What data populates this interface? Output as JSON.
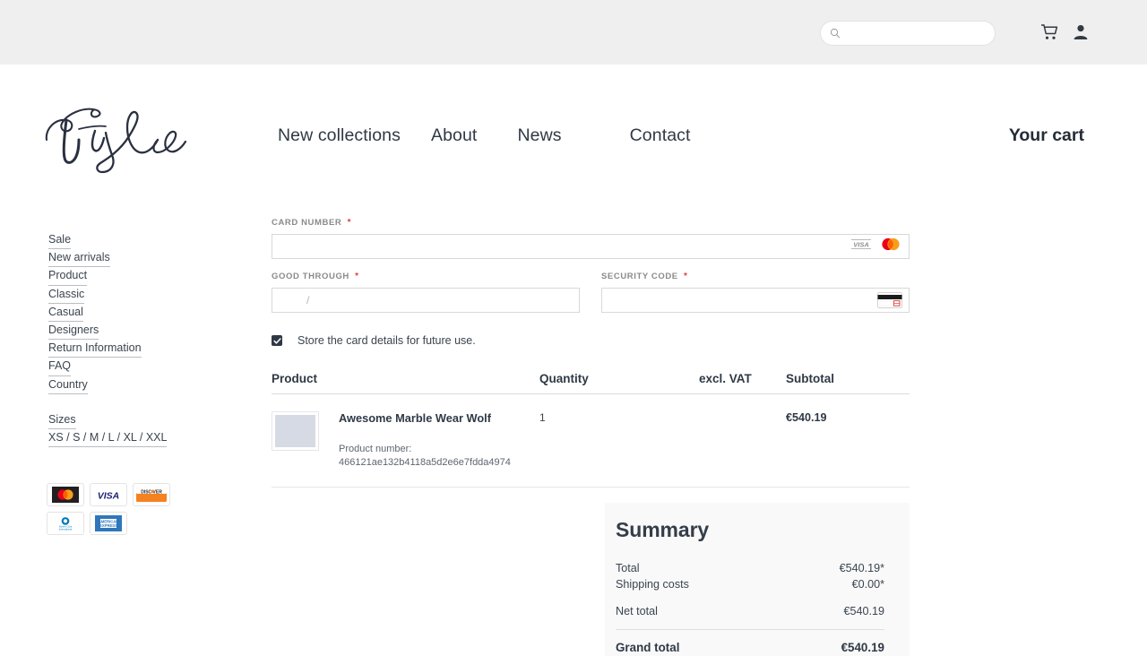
{
  "topbar": {
    "search": {
      "value": "",
      "placeholder": "",
      "icon": "search-icon"
    },
    "cart_icon": "shopping-cart-icon",
    "account_icon": "user-account-icon"
  },
  "header": {
    "logo_text": "Style",
    "nav": [
      {
        "label": "New collections"
      },
      {
        "label": "About"
      },
      {
        "label": "News"
      },
      {
        "label": "Contact"
      }
    ],
    "cart_link": "Your cart"
  },
  "sidebar": {
    "links": [
      {
        "label": "Sale"
      },
      {
        "label": "New arrivals"
      },
      {
        "label": "Product"
      },
      {
        "label": "Classic"
      },
      {
        "label": "Casual"
      },
      {
        "label": "Designers"
      },
      {
        "label": "Return Information"
      },
      {
        "label": "FAQ"
      },
      {
        "label": "Country"
      }
    ],
    "sizes_heading": "Sizes",
    "sizes_value": "XS / S / M / L / XL / XXL",
    "payment_badges": [
      {
        "name": "mastercard-badge",
        "label": "Mastercard"
      },
      {
        "name": "visa-badge",
        "label": "VISA"
      },
      {
        "name": "discover-badge",
        "label": "DISCOVER"
      },
      {
        "name": "diners-club-badge",
        "label": "Diners Club International"
      },
      {
        "name": "amex-badge",
        "label": "AMERICAN EXPRESS"
      }
    ]
  },
  "payment_form": {
    "card_number": {
      "label": "CARD NUMBER",
      "required_mark": "*",
      "value": "",
      "placeholder": "",
      "icons": [
        "visa-icon",
        "mastercard-icon"
      ]
    },
    "good_through": {
      "label": "GOOD THROUGH",
      "required_mark": "*",
      "value": "",
      "placeholder": "/"
    },
    "security_code": {
      "label": "SECURITY CODE",
      "required_mark": "*",
      "value": "",
      "placeholder": "",
      "icon": "cvv-card-icon"
    },
    "store_card": {
      "label": "Store the card details for future use.",
      "checked": true
    }
  },
  "cart_table": {
    "headers": {
      "product": "Product",
      "quantity": "Quantity",
      "vat": "excl. VAT",
      "subtotal": "Subtotal"
    },
    "rows": [
      {
        "name": "Awesome Marble Wear Wolf",
        "product_number_label": "Product number:",
        "product_number": "466121ae132b4118a5d2e6e7fdda4974",
        "quantity": "1",
        "vat": "",
        "subtotal": "€540.19"
      }
    ]
  },
  "summary": {
    "title": "Summary",
    "rows": [
      {
        "label": "Total",
        "value": "€540.19*"
      },
      {
        "label": "Shipping costs",
        "value": "€0.00*"
      },
      {
        "label": "Net total",
        "value": "€540.19"
      }
    ],
    "grand_total": {
      "label": "Grand total",
      "value": "€540.19"
    }
  },
  "colors": {
    "topbar_bg": "#efefef",
    "text": "#2f3945",
    "required": "#d9433f",
    "summary_bg": "#f9f9f9",
    "thumb_placeholder": "#d6dae4"
  }
}
